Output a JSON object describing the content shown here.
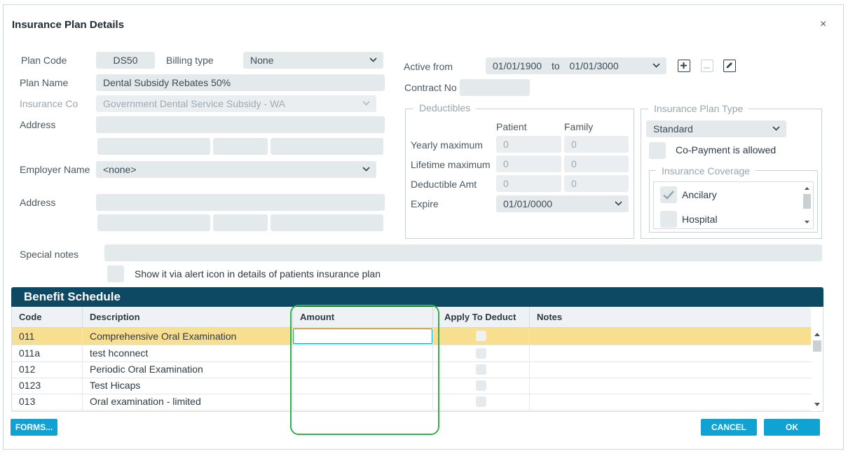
{
  "dialog": {
    "title": "Insurance Plan Details",
    "close_symbol": "×"
  },
  "form": {
    "plan_code_label": "Plan Code",
    "plan_code_value": "DS50",
    "billing_type_label": "Billing type",
    "billing_type_value": "None",
    "plan_name_label": "Plan Name",
    "plan_name_value": "Dental Subsidy Rebates 50%",
    "insurance_co_label": "Insurance Co",
    "insurance_co_value": "Government Dental Service Subsidy - WA",
    "address_label": "Address",
    "employer_name_label": "Employer Name",
    "employer_name_value": "<none>",
    "employer_address_label": "Address",
    "special_notes_label": "Special notes",
    "show_alert_label": "Show it via alert icon in details of patients insurance plan",
    "active_from_label": "Active from",
    "active_from_value": "01/01/1900",
    "active_to_word": "to",
    "active_to_value": "01/01/3000",
    "contract_no_label": "Contract No"
  },
  "deductibles": {
    "legend": "Deductibles",
    "patient_header": "Patient",
    "family_header": "Family",
    "yearly_max_label": "Yearly maximum",
    "yearly_patient": "0",
    "yearly_family": "0",
    "lifetime_max_label": "Lifetime maximum",
    "lifetime_patient": "0",
    "lifetime_family": "0",
    "deductible_amt_label": "Deductible Amt",
    "deductible_patient": "0",
    "deductible_family": "0",
    "expire_label": "Expire",
    "expire_value": "01/01/0000"
  },
  "plan_type": {
    "legend": "Insurance Plan Type",
    "value": "Standard",
    "copayment_label": "Co-Payment is allowed",
    "coverage_legend": "Insurance Coverage",
    "coverage_items": [
      {
        "label": "Ancilary",
        "checked": true
      },
      {
        "label": "Hospital",
        "checked": false
      }
    ]
  },
  "benefit_schedule": {
    "title": "Benefit Schedule",
    "columns": [
      "Code",
      "Description",
      "Amount",
      "Apply To Deduct",
      "Notes"
    ],
    "rows": [
      {
        "code": "011",
        "description": "Comprehensive Oral Examination"
      },
      {
        "code": "011a",
        "description": "test hconnect"
      },
      {
        "code": "012",
        "description": "Periodic Oral Examination"
      },
      {
        "code": "0123",
        "description": "Test Hicaps"
      },
      {
        "code": "013",
        "description": "Oral examination - limited"
      }
    ]
  },
  "buttons": {
    "forms": "FORMS...",
    "cancel": "CANCEL",
    "ok": "OK"
  },
  "colors": {
    "header_bg": "#0e4964",
    "accent": "#0fa2d3",
    "selected_row": "#f8df8f",
    "highlight": "#2fb34a"
  }
}
